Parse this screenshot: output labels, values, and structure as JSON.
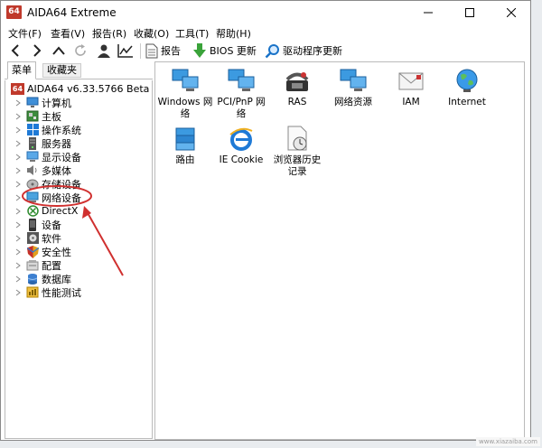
{
  "window": {
    "title": "AIDA64 Extreme",
    "logo_text": "64"
  },
  "menu": [
    "文件(F)",
    "查看(V)",
    "报告(R)",
    "收藏(O)",
    "工具(T)",
    "帮助(H)"
  ],
  "toolbar": {
    "report_label": "报告",
    "bios_label": "BIOS 更新",
    "driver_label": "驱动程序更新"
  },
  "tabs": {
    "menu": "菜单",
    "favorites": "收藏夹"
  },
  "tree": {
    "root": "AIDA64 v6.33.5766 Beta",
    "root_icon_text": "64",
    "items": [
      "计算机",
      "主板",
      "操作系统",
      "服务器",
      "显示设备",
      "多媒体",
      "存储设备",
      "网络设备",
      "DirectX",
      "设备",
      "软件",
      "安全性",
      "配置",
      "数据库",
      "性能测试"
    ]
  },
  "content": {
    "items": [
      {
        "label": "Windows 网络"
      },
      {
        "label": "PCI/PnP 网络"
      },
      {
        "label": "RAS"
      },
      {
        "label": "网络资源"
      },
      {
        "label": "IAM"
      },
      {
        "label": "Internet"
      },
      {
        "label": "路由"
      },
      {
        "label": "IE Cookie"
      },
      {
        "label": "浏览器历史记录"
      }
    ]
  },
  "colors": {
    "accent": "#1a73c8",
    "annotation": "#d0302f"
  },
  "watermark": "www.xiazaiba.com"
}
